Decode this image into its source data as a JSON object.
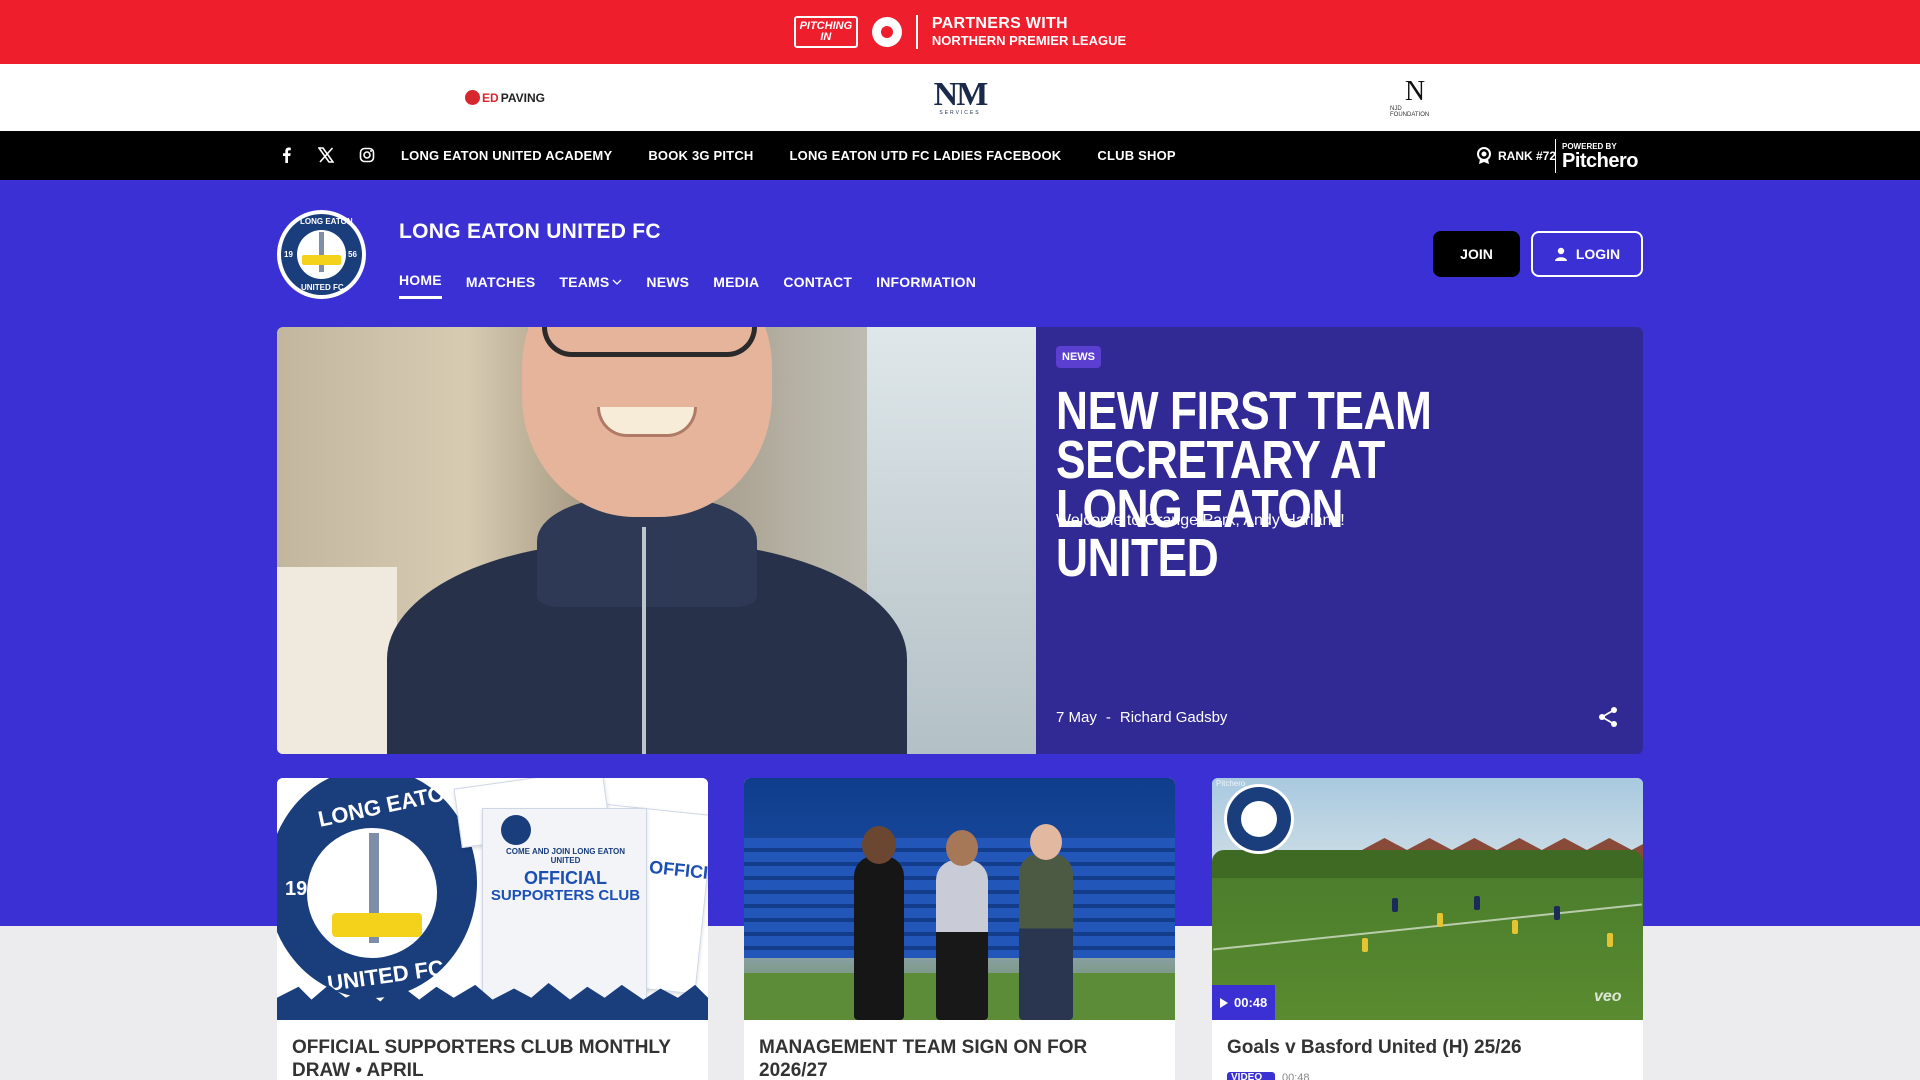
{
  "promo": {
    "pitching_in_line1": "PITCHING",
    "pitching_in_line2": "IN",
    "line1": "PARTNERS WITH",
    "line2": "NORTHERN PREMIER LEAGUE"
  },
  "sponsors": {
    "red_paving_lead": "ED",
    "red_paving_rest": "PAVING",
    "nm": "NM",
    "nm_sub": "SERVICES",
    "nj": "N",
    "nj_sub": "NJD FOUNDATION"
  },
  "utility": {
    "social": [
      {
        "icon": "facebook-icon",
        "glyph": "f"
      },
      {
        "icon": "x-icon",
        "glyph": "𝕏"
      },
      {
        "icon": "instagram-icon",
        "glyph": "◎"
      }
    ],
    "links": [
      "LONG EATON UNITED ACADEMY",
      "BOOK 3G PITCH",
      "LONG EATON UTD FC LADIES FACEBOOK",
      "CLUB SHOP"
    ],
    "rank": "RANK #72",
    "powered_by": "POWERED BY",
    "pitchero": "Pitchero"
  },
  "club": {
    "name": "LONG EATON UNITED FC",
    "crest_top": "LONG EATON",
    "crest_bottom": "UNITED FC",
    "crest_left": "19",
    "crest_right": "56",
    "nav": [
      "HOME",
      "MATCHES",
      "TEAMS",
      "NEWS",
      "MEDIA",
      "CONTACT",
      "INFORMATION"
    ],
    "join": "JOIN",
    "login": "LOGIN"
  },
  "hero": {
    "tag": "NEWS",
    "title": "NEW FIRST TEAM SECRETARY AT LONG EATON UNITED",
    "subtitle": "Welcome to Grange Park, Andy Harland!",
    "date": "7 May",
    "separator": "-",
    "author": "Richard Gadsby"
  },
  "cards": [
    {
      "title": "OFFICIAL SUPPORTERS CLUB MONTHLY DRAW • APRIL",
      "crest_top": "LONG EATON",
      "crest_bottom": "UNITED FC",
      "crest_num": "19",
      "leaflet_title_1": "OFFICIAL",
      "leaflet_title_2": "SUPPORTERS CLUB",
      "leaflet_kicker": "COME AND JOIN LONG EATON UNITED"
    },
    {
      "title": "MANAGEMENT TEAM SIGN ON FOR 2026/27"
    },
    {
      "title": "Goals v Basford United (H) 25/26",
      "duration": "00:48",
      "badge": "VIDEO",
      "sub_duration": "00:48",
      "watermark": "veo",
      "source": "Pitchero"
    }
  ],
  "colors": {
    "banner_red": "#ee1e2d",
    "club_blue": "#3a30d4",
    "hero_panel": "#322a94",
    "crest_navy": "#1a3d7c"
  }
}
